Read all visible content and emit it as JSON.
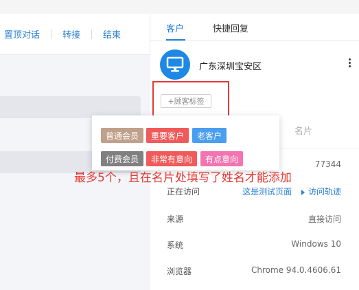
{
  "toolbar": {
    "pin_label": "置顶对话",
    "transfer_label": "转接",
    "end_label": "结束"
  },
  "tabs": [
    {
      "label": "客户",
      "active": true
    },
    {
      "label": "快捷回复",
      "active": false
    }
  ],
  "customer": {
    "avatar_icon": "monitor-icon",
    "region": "广东深圳宝安区",
    "more_icon": "more-vertical-icon"
  },
  "tag_button": {
    "label": "+顾客标签"
  },
  "card_tab_label": "名片",
  "info": {
    "id_value": "77344",
    "visiting": {
      "label": "正在访问",
      "value": "这是测试页面",
      "track": "访问轨迹"
    },
    "source": {
      "label": "来源",
      "value": "直接访问"
    },
    "system": {
      "label": "系统",
      "value": "Windows 10"
    },
    "browser": {
      "label": "浏览器",
      "value": "Chrome 94.0.4606.61"
    }
  },
  "tag_popup": {
    "row1": [
      {
        "label": "普通会员",
        "color": "#c0a08a"
      },
      {
        "label": "重要客户",
        "color": "#f05a5a"
      },
      {
        "label": "老客户",
        "color": "#4a9ef0"
      }
    ],
    "row2": [
      {
        "label": "付费会员",
        "color": "#808080"
      },
      {
        "label": "非常有意向",
        "color": "#f05a5a"
      },
      {
        "label": "有点意向",
        "color": "#f274b0"
      }
    ]
  },
  "annotation": "最多5个，且在名片处填写了姓名才能添加",
  "colors": {
    "accent": "#2a7fd4",
    "annotation_red": "#e53935",
    "avatar_blue": "#1e88e5"
  }
}
